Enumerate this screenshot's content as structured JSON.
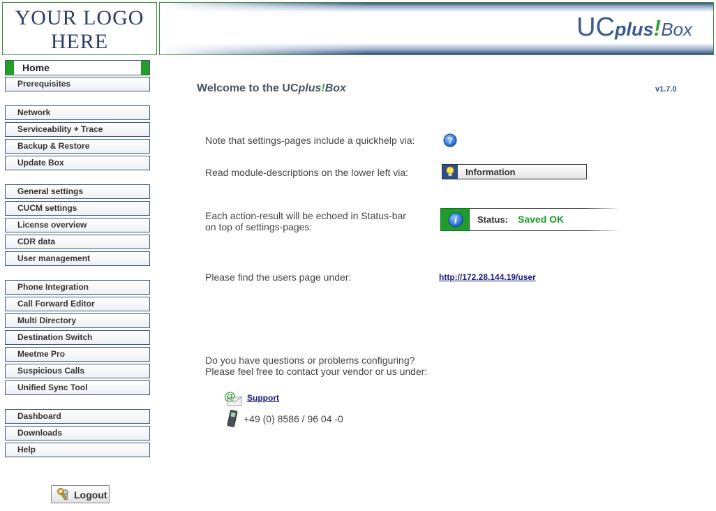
{
  "header": {
    "logo_line1": "YOUR LOGO",
    "logo_line2": "HERE",
    "brand_uc": "UC",
    "brand_plus": "plus",
    "brand_bang": "!",
    "brand_box": "Box"
  },
  "sidebar": {
    "home": "Home",
    "groups": [
      [
        "Prerequisites"
      ],
      [
        "Network",
        "Serviceability + Trace",
        "Backup & Restore",
        "Update Box"
      ],
      [
        "General settings",
        "CUCM settings",
        "License overview",
        "CDR data",
        "User management"
      ],
      [
        "Phone Integration",
        "Call Forward Editor",
        "Multi Directory",
        "Destination Switch",
        "Meetme Pro",
        "Suspicious Calls",
        "Unified Sync Tool"
      ],
      [
        "Dashboard",
        "Downloads",
        "Help"
      ]
    ],
    "logout": "Logout"
  },
  "main": {
    "welcome_prefix": "Welcome to the UC",
    "welcome_plus": "plus",
    "welcome_bang": "!",
    "welcome_box": "Box",
    "version": "v1.7.0",
    "quickhelp_text": "Note that settings-pages include a quickhelp via:",
    "module_text": "Read module-descriptions on the lower left via:",
    "information_button": "Information",
    "echo_line1": "Each action-result will be echoed in Status-bar",
    "echo_line2": "on top of settings-pages:",
    "status_label": "Status:",
    "status_value": "Saved OK",
    "users_text": "Please find the users page under:",
    "users_link": "http://172.28.144.19/user",
    "questions_line1": "Do you have questions or problems configuring?",
    "questions_line2": "Please feel free to contact your vendor or us under:",
    "support_link": "Support",
    "phone": "+49 (0) 8586 / 96 04 -0"
  },
  "colors": {
    "accent_green": "#23a023",
    "nav_border": "#3c5a7d",
    "brand_blue": "#3c5a8f",
    "status_ok": "#1f9c2e"
  },
  "icons": [
    "help-question-icon",
    "lightbulb-icon",
    "info-icon",
    "email-at-icon",
    "mobile-phone-icon",
    "keys-icon"
  ]
}
